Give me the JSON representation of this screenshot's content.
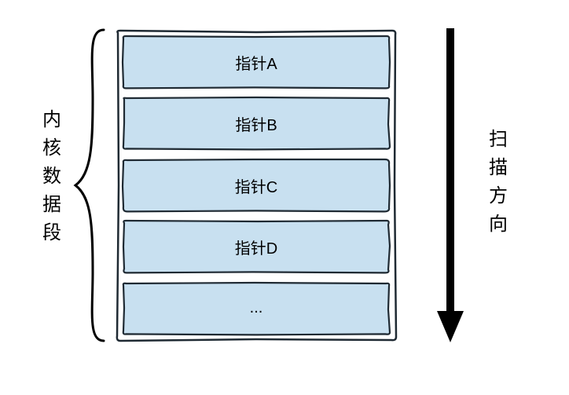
{
  "left_label": "内核数据段",
  "right_label": "扫描方向",
  "cells": {
    "c0": "指针A",
    "c1": "指针B",
    "c2": "指针C",
    "c3": "指针D",
    "c4": "..."
  },
  "colors": {
    "cell_fill": "#c8e0f0",
    "cell_stroke": "#1f2a33",
    "outer_stroke": "#1f2a33",
    "arrow": "#000000"
  }
}
